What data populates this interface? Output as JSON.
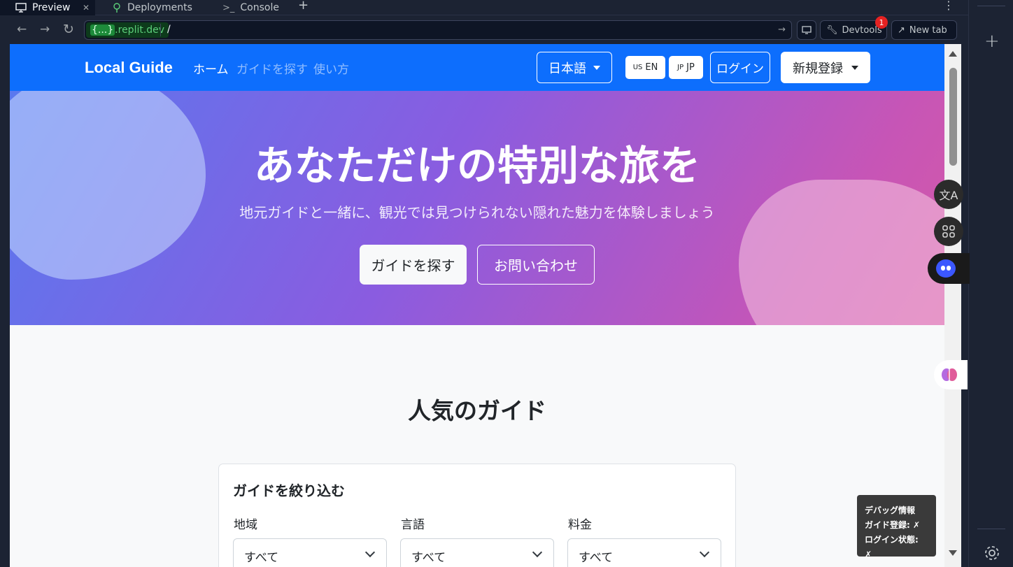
{
  "ide": {
    "tabs": [
      {
        "label": "Preview",
        "icon": "monitor-icon"
      },
      {
        "label": "Deployments",
        "icon": "deploy-icon"
      },
      {
        "label": "Console",
        "icon": "terminal-icon"
      }
    ],
    "url": {
      "domain_highlight": "{...}",
      "domain_suffix": ".replit.dev",
      "path": "/"
    },
    "devtools_label": "Devtools",
    "devtools_badge": "1",
    "newtab_label": "New tab"
  },
  "site": {
    "brand": "Local Guide",
    "nav": [
      {
        "label": "ホーム",
        "active": true
      },
      {
        "label": "ガイドを探す",
        "active": false
      },
      {
        "label": "使い方",
        "active": false
      }
    ],
    "language_dropdown": "日本語",
    "lang_en": {
      "flag": "US",
      "label": "EN"
    },
    "lang_jp": {
      "flag": "JP",
      "label": "JP"
    },
    "login": "ログイン",
    "signup": "新規登録",
    "hero": {
      "title": "あなただけの特別な旅を",
      "subtitle": "地元ガイドと一緒に、観光では見つけられない隠れた魅力を体験しましょう",
      "primary_button": "ガイドを探す",
      "secondary_button": "お問い合わせ"
    },
    "popular_heading": "人気のガイド",
    "filter": {
      "title": "ガイドを絞り込む",
      "fields": [
        {
          "label": "地域",
          "value": "すべて"
        },
        {
          "label": "言語",
          "value": "すべて"
        },
        {
          "label": "料金",
          "value": "すべて"
        }
      ]
    },
    "debug": {
      "title": "デバッグ情報",
      "guide_registration": "ガイド登録: ✗",
      "login_state": "ログイン状態: ✗"
    }
  },
  "colors": {
    "nav_bg": "#0d6efd",
    "hero_start": "#5a78ee",
    "hero_end": "#d45aa8",
    "ide_bg": "#1c2333"
  }
}
